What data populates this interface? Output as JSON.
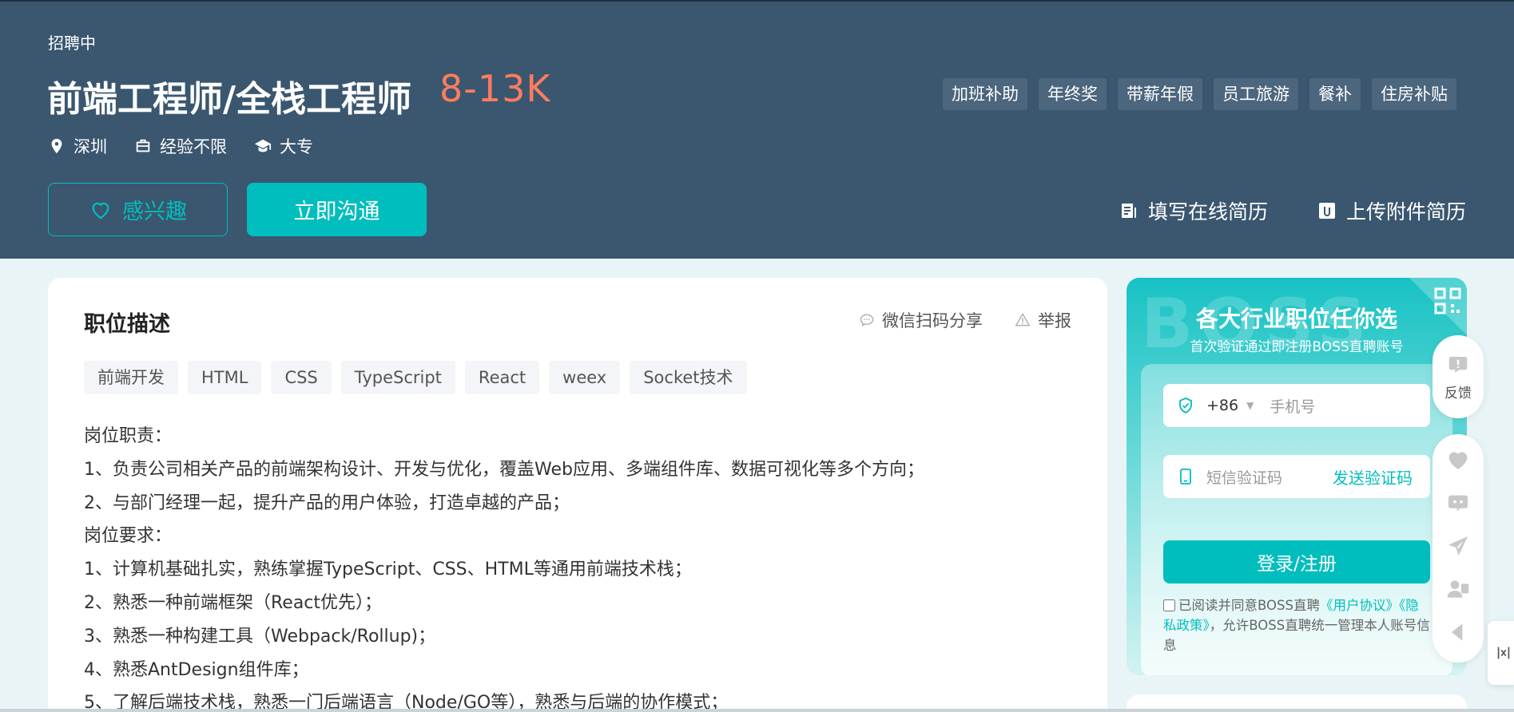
{
  "header": {
    "status": "招聘中",
    "job_title": "前端工程师/全栈工程师",
    "salary": "8-13K",
    "meta": {
      "city": "深圳",
      "experience": "经验不限",
      "degree": "大专"
    },
    "benefits": [
      "加班补助",
      "年终奖",
      "带薪年假",
      "员工旅游",
      "餐补",
      "住房补贴"
    ],
    "interest_label": "感兴趣",
    "chat_label": "立即沟通",
    "online_resume_label": "填写在线简历",
    "upload_resume_label": "上传附件简历"
  },
  "job": {
    "section_title": "职位描述",
    "share_label": "微信扫码分享",
    "report_label": "举报",
    "skills": [
      "前端开发",
      "HTML",
      "CSS",
      "TypeScript",
      "React",
      "weex",
      "Socket技术"
    ],
    "description": [
      "岗位职责：",
      "1、负责公司相关产品的前端架构设计、开发与优化，覆盖Web应用、多端组件库、数据可视化等多个方向；",
      "2、与部门经理一起，提升产品的用户体验，打造卓越的产品；",
      "岗位要求：",
      "1、计算机基础扎实，熟练掌握TypeScript、CSS、HTML等通用前端技术栈；",
      "2、熟悉一种前端框架（React优先）；",
      "3、熟悉一种构建工具（Webpack/Rollup)；",
      "4、熟悉AntDesign组件库；",
      "5、了解后端技术栈，熟悉一门后端语言（Node/GO等），熟悉与后端的协作模式；"
    ]
  },
  "login_panel": {
    "watermark": "BOSS",
    "heading": "各大行业职位任你选",
    "subheading": "首次验证通过即注册BOSS直聘账号",
    "country_code": "+86",
    "phone_placeholder": "手机号",
    "sms_placeholder": "短信验证码",
    "send_code_label": "发送验证码",
    "login_label": "登录/注册",
    "agreement_prefix": "已阅读并同意BOSS直聘",
    "user_agreement": "《用户协议》",
    "privacy_policy": "《隐私政策》",
    "agreement_suffix": "，允许BOSS直聘统一管理本人账号信息"
  },
  "float_bar": {
    "feedback_label": "反馈"
  },
  "colors": {
    "header_bg": "#3a576f",
    "accent": "#00bebd",
    "salary": "#fe7c5e",
    "page_bg": "#e9f4f7"
  }
}
